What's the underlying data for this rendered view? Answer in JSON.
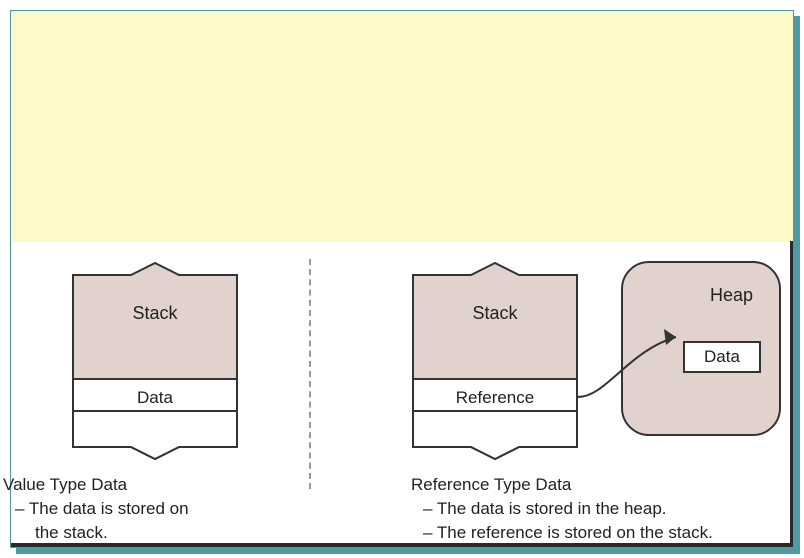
{
  "left": {
    "stack_label": "Stack",
    "row_label": "Data",
    "caption_title": "Value Type Data",
    "caption_line1": "– The data is stored on",
    "caption_line2": "   the stack."
  },
  "right": {
    "stack_label": "Stack",
    "row_label": "Reference",
    "heap_label": "Heap",
    "heap_data_label": "Data",
    "caption_title": "Reference Type Data",
    "caption_line1": "– The data is stored in the heap.",
    "caption_line2": "– The reference is stored on the stack."
  }
}
